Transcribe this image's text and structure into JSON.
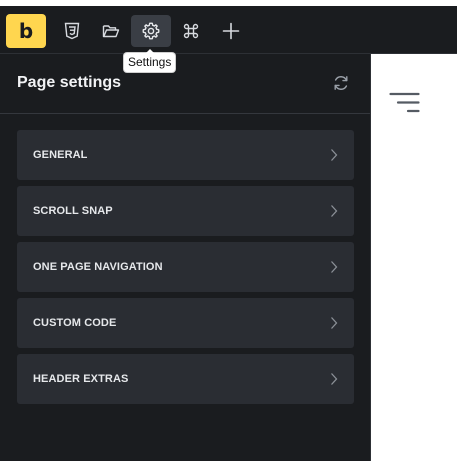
{
  "toolbar": {
    "logo_letter": "b",
    "buttons": [
      {
        "icon": "css3-icon"
      },
      {
        "icon": "folder-icon"
      },
      {
        "icon": "gear-icon"
      },
      {
        "icon": "command-icon"
      },
      {
        "icon": "plus-icon"
      }
    ],
    "tooltip": "Settings"
  },
  "panel": {
    "title": "Page settings",
    "refresh_icon": "refresh-icon",
    "sections": [
      {
        "label": "GENERAL"
      },
      {
        "label": "SCROLL SNAP"
      },
      {
        "label": "ONE PAGE NAVIGATION"
      },
      {
        "label": "CUSTOM CODE"
      },
      {
        "label": "HEADER EXTRAS"
      }
    ]
  },
  "canvas": {
    "menu_icon": "hamburger-menu-icon"
  },
  "colors": {
    "accent": "#ffd64f",
    "panel_bg": "#1a1c1f",
    "section_bg": "#2a2d33",
    "active_button_bg": "#3a3e45"
  }
}
